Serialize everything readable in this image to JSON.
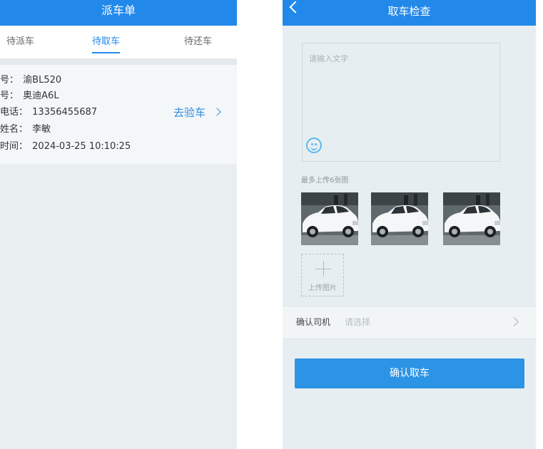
{
  "left": {
    "title": "派车单",
    "tabs": [
      {
        "label": "待派车"
      },
      {
        "label": "待取车"
      },
      {
        "label": "待还车"
      }
    ],
    "order": {
      "fields": [
        {
          "label": "牌号：",
          "value": "渝BL520"
        },
        {
          "label": "型号：",
          "value": "奥迪A6L"
        },
        {
          "label": "机电话：",
          "value": "13356455687"
        },
        {
          "label": "机姓名：",
          "value": "李敏"
        },
        {
          "label": "车时间：",
          "value": "2024-03-25 10:10:25"
        }
      ],
      "action_label": "去验车"
    }
  },
  "right": {
    "title": "取车检查",
    "remark": {
      "placeholder": "请输入文字"
    },
    "upload_hint": "最多上传6张图",
    "upload_label": "上传图片",
    "driver": {
      "label": "确认司机",
      "placeholder": "请选择"
    },
    "confirm_label": "确认取车"
  },
  "colors": {
    "primary": "#2289ea",
    "link": "#2f8ee6",
    "button": "#2c94e5"
  },
  "icons": [
    "back-arrow-icon",
    "chevron-right-icon",
    "smiley-icon",
    "plus-icon"
  ]
}
